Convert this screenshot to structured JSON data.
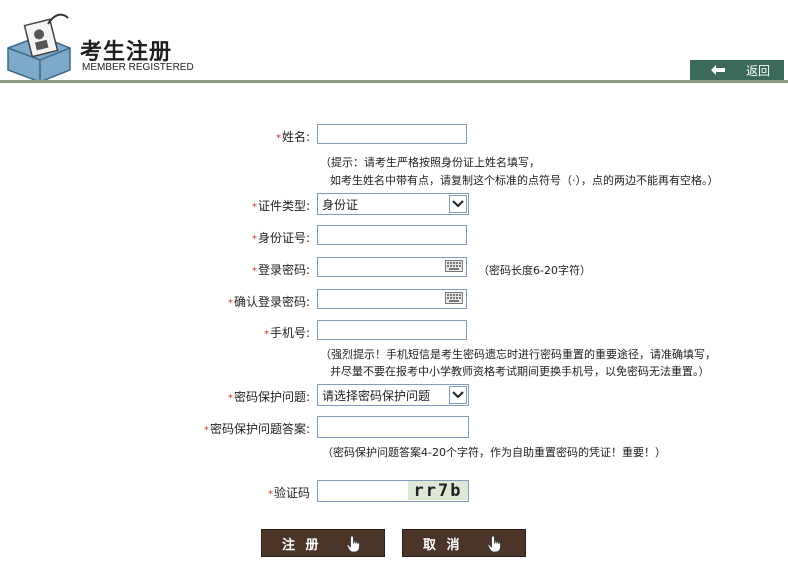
{
  "header": {
    "title_cn": "考生注册",
    "title_en": "MEMBER REGISTERED",
    "back_label": "返回"
  },
  "form": {
    "required_mark": "*",
    "name": {
      "label": "姓名:",
      "value": ""
    },
    "name_hint_1": "（提示：请考生严格按照身份证上姓名填写，",
    "name_hint_2": "如考生姓名中带有点，请复制这个标准的点符号（·），点的两边不能再有空格。）",
    "id_type": {
      "label": "证件类型:",
      "selected": "身份证"
    },
    "id_number": {
      "label": "身份证号:",
      "value": ""
    },
    "password": {
      "label": "登录密码:",
      "value": "",
      "hint": "（密码长度6-20字符）"
    },
    "confirm_password": {
      "label": "确认登录密码:",
      "value": ""
    },
    "phone": {
      "label": "手机号:",
      "value": ""
    },
    "phone_hint_1": "（强烈提示！手机短信是考生密码遗忘时进行密码重置的重要途径，请准确填写，",
    "phone_hint_2": "并尽量不要在报考中小学教师资格考试期间更换手机号，以免密码无法重置。）",
    "security_question": {
      "label": "密码保护问题:",
      "selected": "请选择密码保护问题"
    },
    "security_answer": {
      "label": "密码保护问题答案:",
      "value": ""
    },
    "answer_hint": "（密码保护问题答案4-20个字符，作为自助重置密码的凭证！重要！）",
    "captcha": {
      "label": "验证码",
      "image_text": "rr7b",
      "value": ""
    }
  },
  "buttons": {
    "register": "注 册",
    "cancel": "取 消"
  },
  "colors": {
    "back_button": "#3b6a5b",
    "action_button": "#4a3528",
    "required_star": "#c0392b",
    "captcha_bg": "#dde8d6",
    "input_border": "#7f9db9"
  }
}
